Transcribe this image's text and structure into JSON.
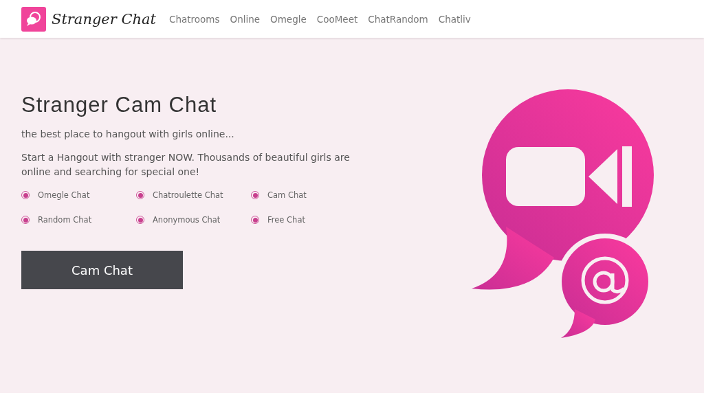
{
  "header": {
    "brand": "Stranger Chat",
    "nav": [
      "Chatrooms",
      "Online",
      "Omegle",
      "CooMeet",
      "ChatRandom",
      "Chatliv"
    ]
  },
  "hero": {
    "title": "Stranger Cam Chat",
    "subtitle": "the best place to hangout with girls online...",
    "description": "Start a Hangout with stranger NOW. Thousands of beautiful girls are online and searching for special one!",
    "options": [
      {
        "label": "Omegle Chat",
        "selected": true
      },
      {
        "label": "Chatroulette Chat",
        "selected": true
      },
      {
        "label": "Cam Chat",
        "selected": true
      },
      {
        "label": "Random Chat",
        "selected": true
      },
      {
        "label": "Anonymous Chat",
        "selected": true
      },
      {
        "label": "Free Chat",
        "selected": true
      }
    ],
    "button": "Cam Chat"
  }
}
